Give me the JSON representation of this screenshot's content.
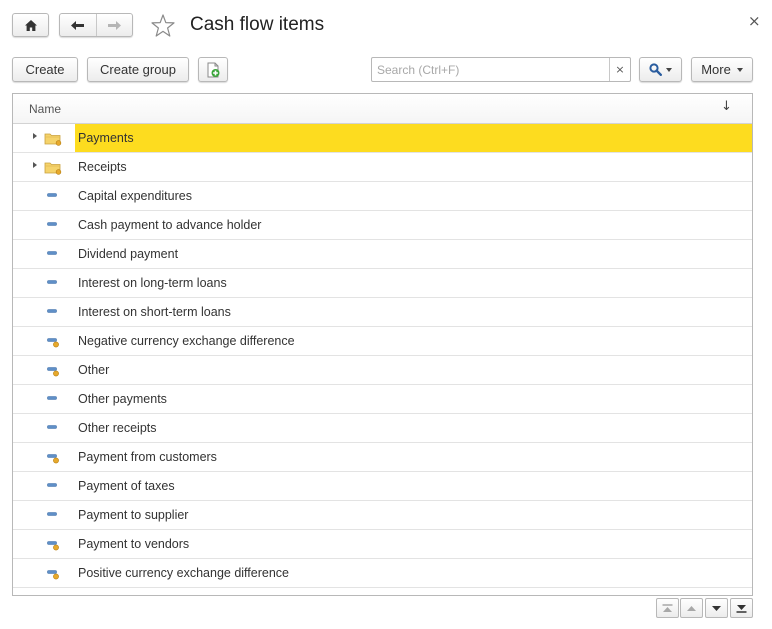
{
  "window": {
    "title": "Cash flow items",
    "close_glyph": "×"
  },
  "toolbar": {
    "create_label": "Create",
    "create_group_label": "Create group",
    "more_label": "More"
  },
  "search": {
    "placeholder": "Search (Ctrl+F)",
    "value": "",
    "clear_glyph": "×"
  },
  "table": {
    "column_name": "Name",
    "sort_glyph": "↓",
    "rows": [
      {
        "label": "Payments",
        "kind": "folder",
        "selected": true
      },
      {
        "label": "Receipts",
        "kind": "folder",
        "selected": false
      },
      {
        "label": "Capital expenditures",
        "kind": "item"
      },
      {
        "label": "Cash payment to advance holder",
        "kind": "item"
      },
      {
        "label": "Dividend payment",
        "kind": "item"
      },
      {
        "label": "Interest on long-term loans",
        "kind": "item"
      },
      {
        "label": "Interest on short-term loans",
        "kind": "item"
      },
      {
        "label": "Negative currency exchange difference",
        "kind": "item-predefined"
      },
      {
        "label": "Other",
        "kind": "item-predefined"
      },
      {
        "label": "Other payments",
        "kind": "item"
      },
      {
        "label": "Other receipts",
        "kind": "item"
      },
      {
        "label": "Payment from customers",
        "kind": "item-predefined"
      },
      {
        "label": "Payment of taxes",
        "kind": "item"
      },
      {
        "label": "Payment to supplier",
        "kind": "item"
      },
      {
        "label": "Payment to vendors",
        "kind": "item-predefined"
      },
      {
        "label": "Positive currency exchange difference",
        "kind": "item-predefined"
      }
    ]
  },
  "icons": {
    "home": "home-icon",
    "back": "arrow-left-icon",
    "forward": "arrow-right-icon",
    "favorite": "star-icon",
    "create_copy": "create-document-icon",
    "search": "magnifier-icon",
    "folder": "folder-icon",
    "item": "item-icon"
  },
  "colors": {
    "selection": "#fddc1f",
    "folder": "#f5d36b",
    "item": "#5f8fc7",
    "predefined_badge": "#e7a92c",
    "add_green": "#3aa53a"
  }
}
